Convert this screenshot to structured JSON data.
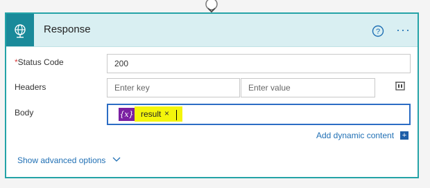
{
  "action": {
    "title": "Response",
    "icon": "globe-icon",
    "help_icon": "help-circle-icon",
    "more_icon": "ellipsis-icon",
    "more_label": "···"
  },
  "fields": {
    "status_code": {
      "required_mark": "*",
      "label": "Status Code",
      "value": "200"
    },
    "headers": {
      "label": "Headers",
      "key_placeholder": "Enter key",
      "value_placeholder": "Enter value"
    },
    "body": {
      "label": "Body",
      "token": {
        "icon_text": "{x}",
        "label": "result",
        "remove_label": "×"
      }
    }
  },
  "links": {
    "add_dynamic_content": "Add dynamic content",
    "add_dynamic_content_icon": "+",
    "show_advanced": "Show advanced options"
  },
  "colors": {
    "accent": "#24a3a7",
    "header_bg": "#d9eff2",
    "link": "#1f6fb4",
    "token_purple": "#7b1fa2",
    "token_highlight": "#f4f50b",
    "focus_border": "#2b6cc4"
  }
}
